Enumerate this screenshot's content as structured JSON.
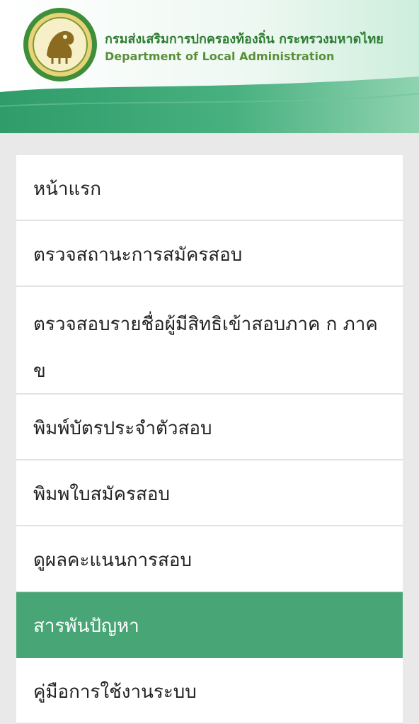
{
  "header": {
    "title_thai": "กรมส่งเสริมการปกครองท้องถิ่น กระทรวงมหาดไทย",
    "title_en": "Department of Local Administration",
    "logo_icon": "dla-seal-icon",
    "colors": {
      "brand_green": "#2e7d32",
      "band_green": "#3fae7e",
      "active_item": "#48a676"
    }
  },
  "menu": {
    "items": [
      {
        "label": "หน้าแรก",
        "active": false
      },
      {
        "label": "ตรวจสถานะการสมัครสอบ",
        "active": false
      },
      {
        "label": "ตรวจสอบรายชื่อผู้มีสิทธิเข้าสอบภาค ก ภาค ข",
        "active": false
      },
      {
        "label": "พิมพ์บัตรประจำตัวสอบ",
        "active": false
      },
      {
        "label": "พิมพใบสมัครสอบ",
        "active": false
      },
      {
        "label": "ดูผลคะแนนการสอบ",
        "active": false
      },
      {
        "label": "สารพันปัญหา",
        "active": true
      },
      {
        "label": "คู่มือการใช้งานระบบ",
        "active": false
      }
    ]
  }
}
